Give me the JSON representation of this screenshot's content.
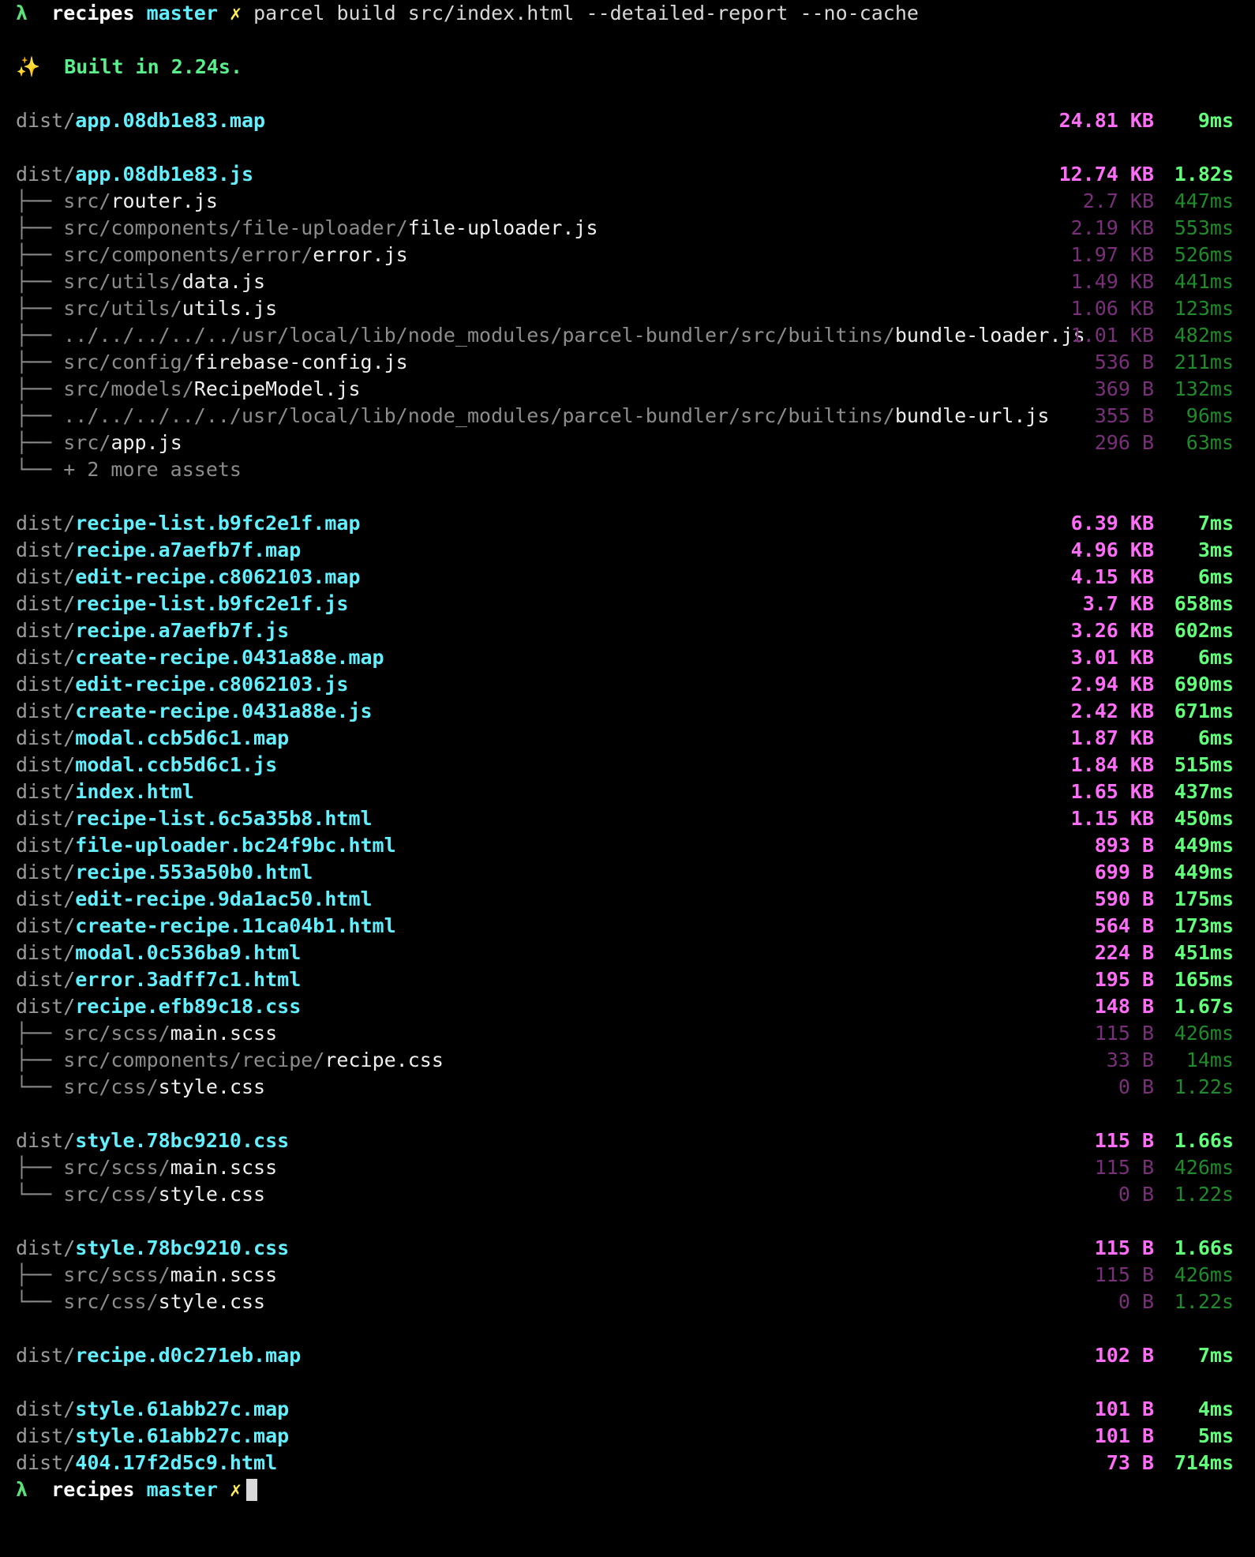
{
  "prompt": {
    "lambda": "λ",
    "repo": "recipes",
    "branch": "master",
    "dirty": "✗",
    "command": "parcel build src/index.html --detailed-report --no-cache"
  },
  "build_status": {
    "icon": "✨",
    "text": "Built in 2.24s."
  },
  "bundles": [
    {
      "dir": "dist/",
      "file": "app.08db1e83.map",
      "size": "24.81 KB",
      "time": "9ms",
      "assets": []
    },
    {
      "dir": "dist/",
      "file": "app.08db1e83.js",
      "size": "12.74 KB",
      "time": "1.82s",
      "assets": [
        {
          "tree": "├── ",
          "dir": "src/",
          "file": "router.js",
          "size": "2.7 KB",
          "time": "447ms"
        },
        {
          "tree": "├── ",
          "dir": "src/components/file-uploader/",
          "file": "file-uploader.js",
          "size": "2.19 KB",
          "time": "553ms"
        },
        {
          "tree": "├── ",
          "dir": "src/components/error/",
          "file": "error.js",
          "size": "1.97 KB",
          "time": "526ms"
        },
        {
          "tree": "├── ",
          "dir": "src/utils/",
          "file": "data.js",
          "size": "1.49 KB",
          "time": "441ms"
        },
        {
          "tree": "├── ",
          "dir": "src/utils/",
          "file": "utils.js",
          "size": "1.06 KB",
          "time": "123ms"
        },
        {
          "tree": "├── ",
          "dir": "../../../../../usr/local/lib/node_modules/parcel-bundler/src/builtins/",
          "file": "bundle-loader.js",
          "size": "1.01 KB",
          "time": "482ms"
        },
        {
          "tree": "├── ",
          "dir": "src/config/",
          "file": "firebase-config.js",
          "size": "536 B",
          "time": "211ms"
        },
        {
          "tree": "├── ",
          "dir": "src/models/",
          "file": "RecipeModel.js",
          "size": "369 B",
          "time": "132ms"
        },
        {
          "tree": "├── ",
          "dir": "../../../../../usr/local/lib/node_modules/parcel-bundler/src/builtins/",
          "file": "bundle-url.js",
          "size": "355 B",
          "time": "96ms"
        },
        {
          "tree": "├── ",
          "dir": "src/",
          "file": "app.js",
          "size": "296 B",
          "time": "63ms"
        },
        {
          "tree": "└── ",
          "dir": "",
          "file": "",
          "more": "+ 2 more assets",
          "size": "",
          "time": ""
        }
      ]
    }
  ],
  "flat_group": [
    {
      "dir": "dist/",
      "file": "recipe-list.b9fc2e1f.map",
      "size": "6.39 KB",
      "time": "7ms"
    },
    {
      "dir": "dist/",
      "file": "recipe.a7aefb7f.map",
      "size": "4.96 KB",
      "time": "3ms"
    },
    {
      "dir": "dist/",
      "file": "edit-recipe.c8062103.map",
      "size": "4.15 KB",
      "time": "6ms"
    },
    {
      "dir": "dist/",
      "file": "recipe-list.b9fc2e1f.js",
      "size": "3.7 KB",
      "time": "658ms"
    },
    {
      "dir": "dist/",
      "file": "recipe.a7aefb7f.js",
      "size": "3.26 KB",
      "time": "602ms"
    },
    {
      "dir": "dist/",
      "file": "create-recipe.0431a88e.map",
      "size": "3.01 KB",
      "time": "6ms"
    },
    {
      "dir": "dist/",
      "file": "edit-recipe.c8062103.js",
      "size": "2.94 KB",
      "time": "690ms"
    },
    {
      "dir": "dist/",
      "file": "create-recipe.0431a88e.js",
      "size": "2.42 KB",
      "time": "671ms"
    },
    {
      "dir": "dist/",
      "file": "modal.ccb5d6c1.map",
      "size": "1.87 KB",
      "time": "6ms"
    },
    {
      "dir": "dist/",
      "file": "modal.ccb5d6c1.js",
      "size": "1.84 KB",
      "time": "515ms"
    },
    {
      "dir": "dist/",
      "file": "index.html",
      "size": "1.65 KB",
      "time": "437ms"
    },
    {
      "dir": "dist/",
      "file": "recipe-list.6c5a35b8.html",
      "size": "1.15 KB",
      "time": "450ms"
    },
    {
      "dir": "dist/",
      "file": "file-uploader.bc24f9bc.html",
      "size": "893 B",
      "time": "449ms"
    },
    {
      "dir": "dist/",
      "file": "recipe.553a50b0.html",
      "size": "699 B",
      "time": "449ms"
    },
    {
      "dir": "dist/",
      "file": "edit-recipe.9da1ac50.html",
      "size": "590 B",
      "time": "175ms"
    },
    {
      "dir": "dist/",
      "file": "create-recipe.11ca04b1.html",
      "size": "564 B",
      "time": "173ms"
    },
    {
      "dir": "dist/",
      "file": "modal.0c536ba9.html",
      "size": "224 B",
      "time": "451ms"
    },
    {
      "dir": "dist/",
      "file": "error.3adff7c1.html",
      "size": "195 B",
      "time": "165ms"
    },
    {
      "dir": "dist/",
      "file": "recipe.efb89c18.css",
      "size": "148 B",
      "time": "1.67s"
    }
  ],
  "recipe_css_assets": [
    {
      "tree": "├── ",
      "dir": "src/scss/",
      "file": "main.scss",
      "size": "115 B",
      "time": "426ms"
    },
    {
      "tree": "├── ",
      "dir": "src/components/recipe/",
      "file": "recipe.css",
      "size": "33 B",
      "time": "14ms"
    },
    {
      "tree": "└── ",
      "dir": "src/css/",
      "file": "style.css",
      "size": "0 B",
      "time": "1.22s"
    }
  ],
  "style_bundles": [
    {
      "dir": "dist/",
      "file": "style.78bc9210.css",
      "size": "115 B",
      "time": "1.66s",
      "assets": [
        {
          "tree": "├── ",
          "dir": "src/scss/",
          "file": "main.scss",
          "size": "115 B",
          "time": "426ms"
        },
        {
          "tree": "└── ",
          "dir": "src/css/",
          "file": "style.css",
          "size": "0 B",
          "time": "1.22s"
        }
      ]
    },
    {
      "dir": "dist/",
      "file": "style.78bc9210.css",
      "size": "115 B",
      "time": "1.66s",
      "assets": [
        {
          "tree": "├── ",
          "dir": "src/scss/",
          "file": "main.scss",
          "size": "115 B",
          "time": "426ms"
        },
        {
          "tree": "└── ",
          "dir": "src/css/",
          "file": "style.css",
          "size": "0 B",
          "time": "1.22s"
        }
      ]
    }
  ],
  "single_map": {
    "dir": "dist/",
    "file": "recipe.d0c271eb.map",
    "size": "102 B",
    "time": "7ms"
  },
  "tail_group": [
    {
      "dir": "dist/",
      "file": "style.61abb27c.map",
      "size": "101 B",
      "time": "4ms"
    },
    {
      "dir": "dist/",
      "file": "style.61abb27c.map",
      "size": "101 B",
      "time": "5ms"
    },
    {
      "dir": "dist/",
      "file": "404.17f2d5c9.html",
      "size": "73 B",
      "time": "714ms"
    }
  ],
  "end_prompt": {
    "lambda": "λ",
    "repo": "recipes",
    "branch": "master",
    "dirty": "✗"
  }
}
